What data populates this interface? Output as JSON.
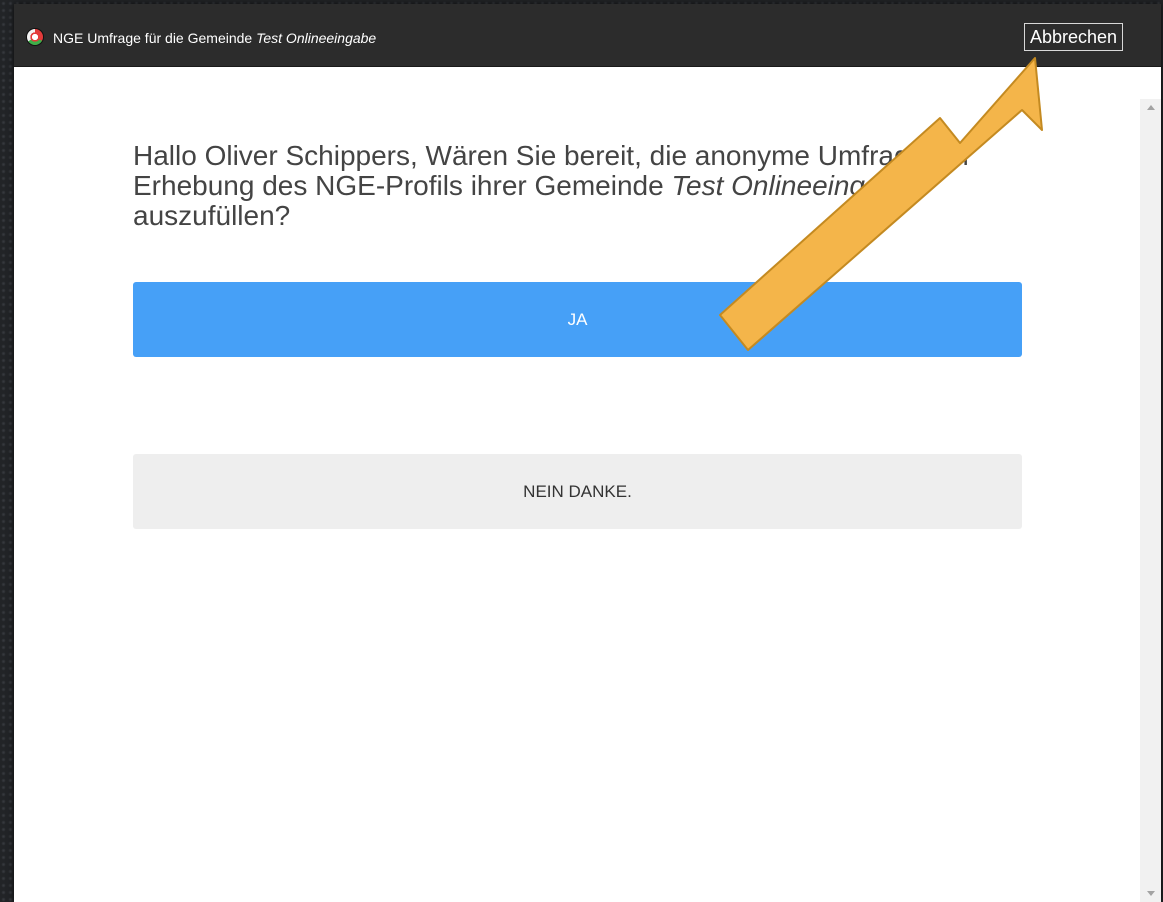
{
  "dialog": {
    "title_prefix": "NGE Umfrage für die Gemeinde",
    "title_community": "Test Onlineeingabe",
    "cancel_label": "Abbrechen"
  },
  "question": {
    "text_before": "Hallo Oliver Schippers, Wären Sie bereit, die anonyme Umfrage zur Erhebung des NGE-Profils ihrer Gemeinde",
    "community": "Test Onlineeingabe",
    "text_after": "auszufüllen?"
  },
  "buttons": {
    "yes_label": "JA",
    "no_label": "NEIN DANKE."
  },
  "annotation": {
    "arrow_color": "#f4b54a",
    "arrow_outline": "#c48a21",
    "points_to": "cancel-button"
  },
  "colors": {
    "titlebar": "#2c2c2c",
    "primary_button": "#46a0f7",
    "secondary_button": "#eeeeee"
  }
}
